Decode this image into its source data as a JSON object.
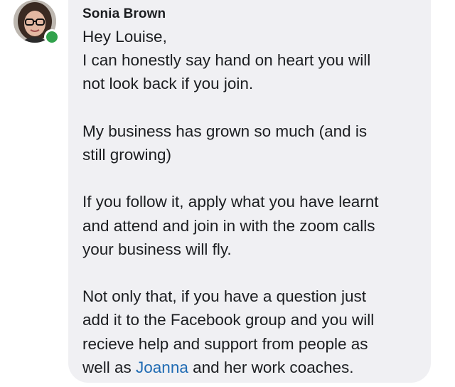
{
  "comment": {
    "author": "Sonia Brown",
    "online_status_color": "#31a24c",
    "paragraphs": {
      "p1": {
        "line1": "Hey Louise,",
        "line2": "I can honestly say hand on heart you will",
        "line3": "not look back if you join."
      },
      "p2": {
        "line1": "My business has grown so much (and is",
        "line2": "still growing)"
      },
      "p3": {
        "line1": "If you follow it, apply what you have learnt",
        "line2": "and attend and join in with the zoom calls",
        "line3": "your business will fly."
      },
      "p4": {
        "line1": "Not only that, if you have a question  just",
        "line2": "add it to the Facebook group and you will",
        "line3": "recieve help and support from people as",
        "line4_before": "well as ",
        "mention": "Joanna",
        "line4_after": " and her work coaches."
      }
    }
  }
}
